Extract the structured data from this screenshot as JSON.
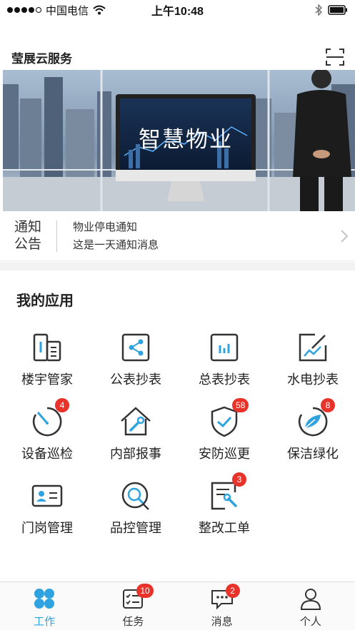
{
  "status_bar": {
    "carrier": "中国电信",
    "time": "上午10:48",
    "signal_icon": "signal-dots-icon",
    "wifi_icon": "wifi-icon",
    "bluetooth_icon": "bluetooth-icon",
    "battery_icon": "battery-icon"
  },
  "header": {
    "title": "莹展云服务",
    "scan_icon": "scan-icon"
  },
  "banner": {
    "screen_text": "智慧物业"
  },
  "notice": {
    "tag_line1": "通知",
    "tag_line2": "公告",
    "title": "物业停电通知",
    "message": "这是一天通知消息"
  },
  "apps_section": {
    "title": "我的应用"
  },
  "apps": [
    {
      "label": "楼宇管家",
      "icon": "building-icon",
      "badge": ""
    },
    {
      "label": "公表抄表",
      "icon": "share-meter-icon",
      "badge": ""
    },
    {
      "label": "总表抄表",
      "icon": "bar-meter-icon",
      "badge": ""
    },
    {
      "label": "水电抄表",
      "icon": "edit-chart-icon",
      "badge": ""
    },
    {
      "label": "设备巡检",
      "icon": "gauge-icon",
      "badge": "4"
    },
    {
      "label": "内部报事",
      "icon": "house-wrench-icon",
      "badge": ""
    },
    {
      "label": "安防巡更",
      "icon": "shield-check-icon",
      "badge": "58"
    },
    {
      "label": "保洁绿化",
      "icon": "leaf-icon",
      "badge": "8"
    },
    {
      "label": "门岗管理",
      "icon": "id-card-icon",
      "badge": ""
    },
    {
      "label": "品控管理",
      "icon": "magnifier-icon",
      "badge": ""
    },
    {
      "label": "整改工单",
      "icon": "doc-wrench-icon",
      "badge": "3"
    }
  ],
  "tabs": [
    {
      "label": "工作",
      "icon": "grid-icon",
      "badge": "",
      "active": true
    },
    {
      "label": "任务",
      "icon": "tasks-icon",
      "badge": "10",
      "active": false
    },
    {
      "label": "消息",
      "icon": "chat-icon",
      "badge": "2",
      "active": false
    },
    {
      "label": "个人",
      "icon": "user-icon",
      "badge": "",
      "active": false
    }
  ],
  "colors": {
    "accent": "#2fa3e0",
    "icon_dark": "#333333",
    "badge": "#e8332a"
  }
}
